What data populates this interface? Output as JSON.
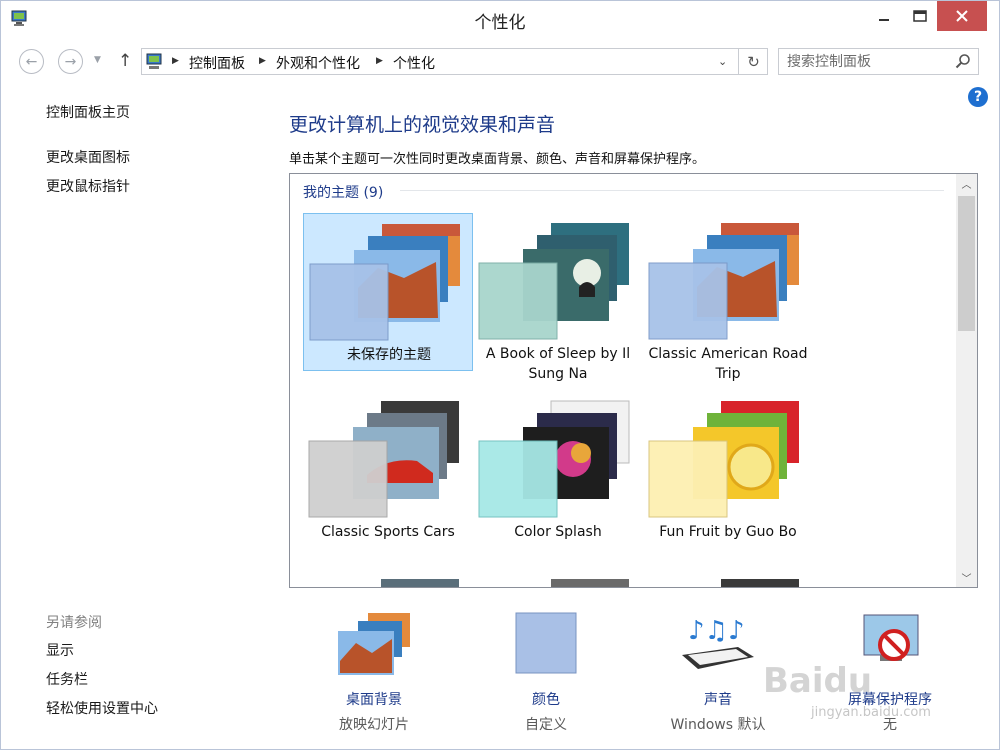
{
  "window": {
    "title": "个性化"
  },
  "address": {
    "crumbs": [
      "控制面板",
      "外观和个性化",
      "个性化"
    ]
  },
  "search": {
    "placeholder": "搜索控制面板"
  },
  "sidebar": {
    "home": "控制面板主页",
    "links": [
      "更改桌面图标",
      "更改鼠标指针"
    ],
    "see_also_title": "另请参阅",
    "see_also": [
      "显示",
      "任务栏",
      "轻松使用设置中心"
    ]
  },
  "main": {
    "heading": "更改计算机上的视觉效果和声音",
    "subtitle": "单击某个主题可一次性同时更改桌面背景、颜色、声音和屏幕保护程序。",
    "group_label": "我的主题 (9)",
    "themes": [
      {
        "line1": "未保存的主题",
        "line2": ""
      },
      {
        "line1": "A Book of Sleep by Il",
        "line2": "Sung Na"
      },
      {
        "line1": "Classic American Road",
        "line2": "Trip"
      },
      {
        "line1": "Classic Sports Cars",
        "line2": ""
      },
      {
        "line1": "Color Splash",
        "line2": ""
      },
      {
        "line1": "Fun Fruit by Guo Bo",
        "line2": ""
      }
    ]
  },
  "bottom": [
    {
      "label": "桌面背景",
      "sub": "放映幻灯片"
    },
    {
      "label": "颜色",
      "sub": "自定义"
    },
    {
      "label": "声音",
      "sub": "Windows 默认"
    },
    {
      "label": "屏幕保护程序",
      "sub": "无"
    }
  ],
  "watermark": {
    "text": "Baidu",
    "sub": "jingyan.baidu.com"
  },
  "colors": {
    "accent": "#1e3b8a",
    "selected": "#cce8ff",
    "close": "#c75050"
  }
}
